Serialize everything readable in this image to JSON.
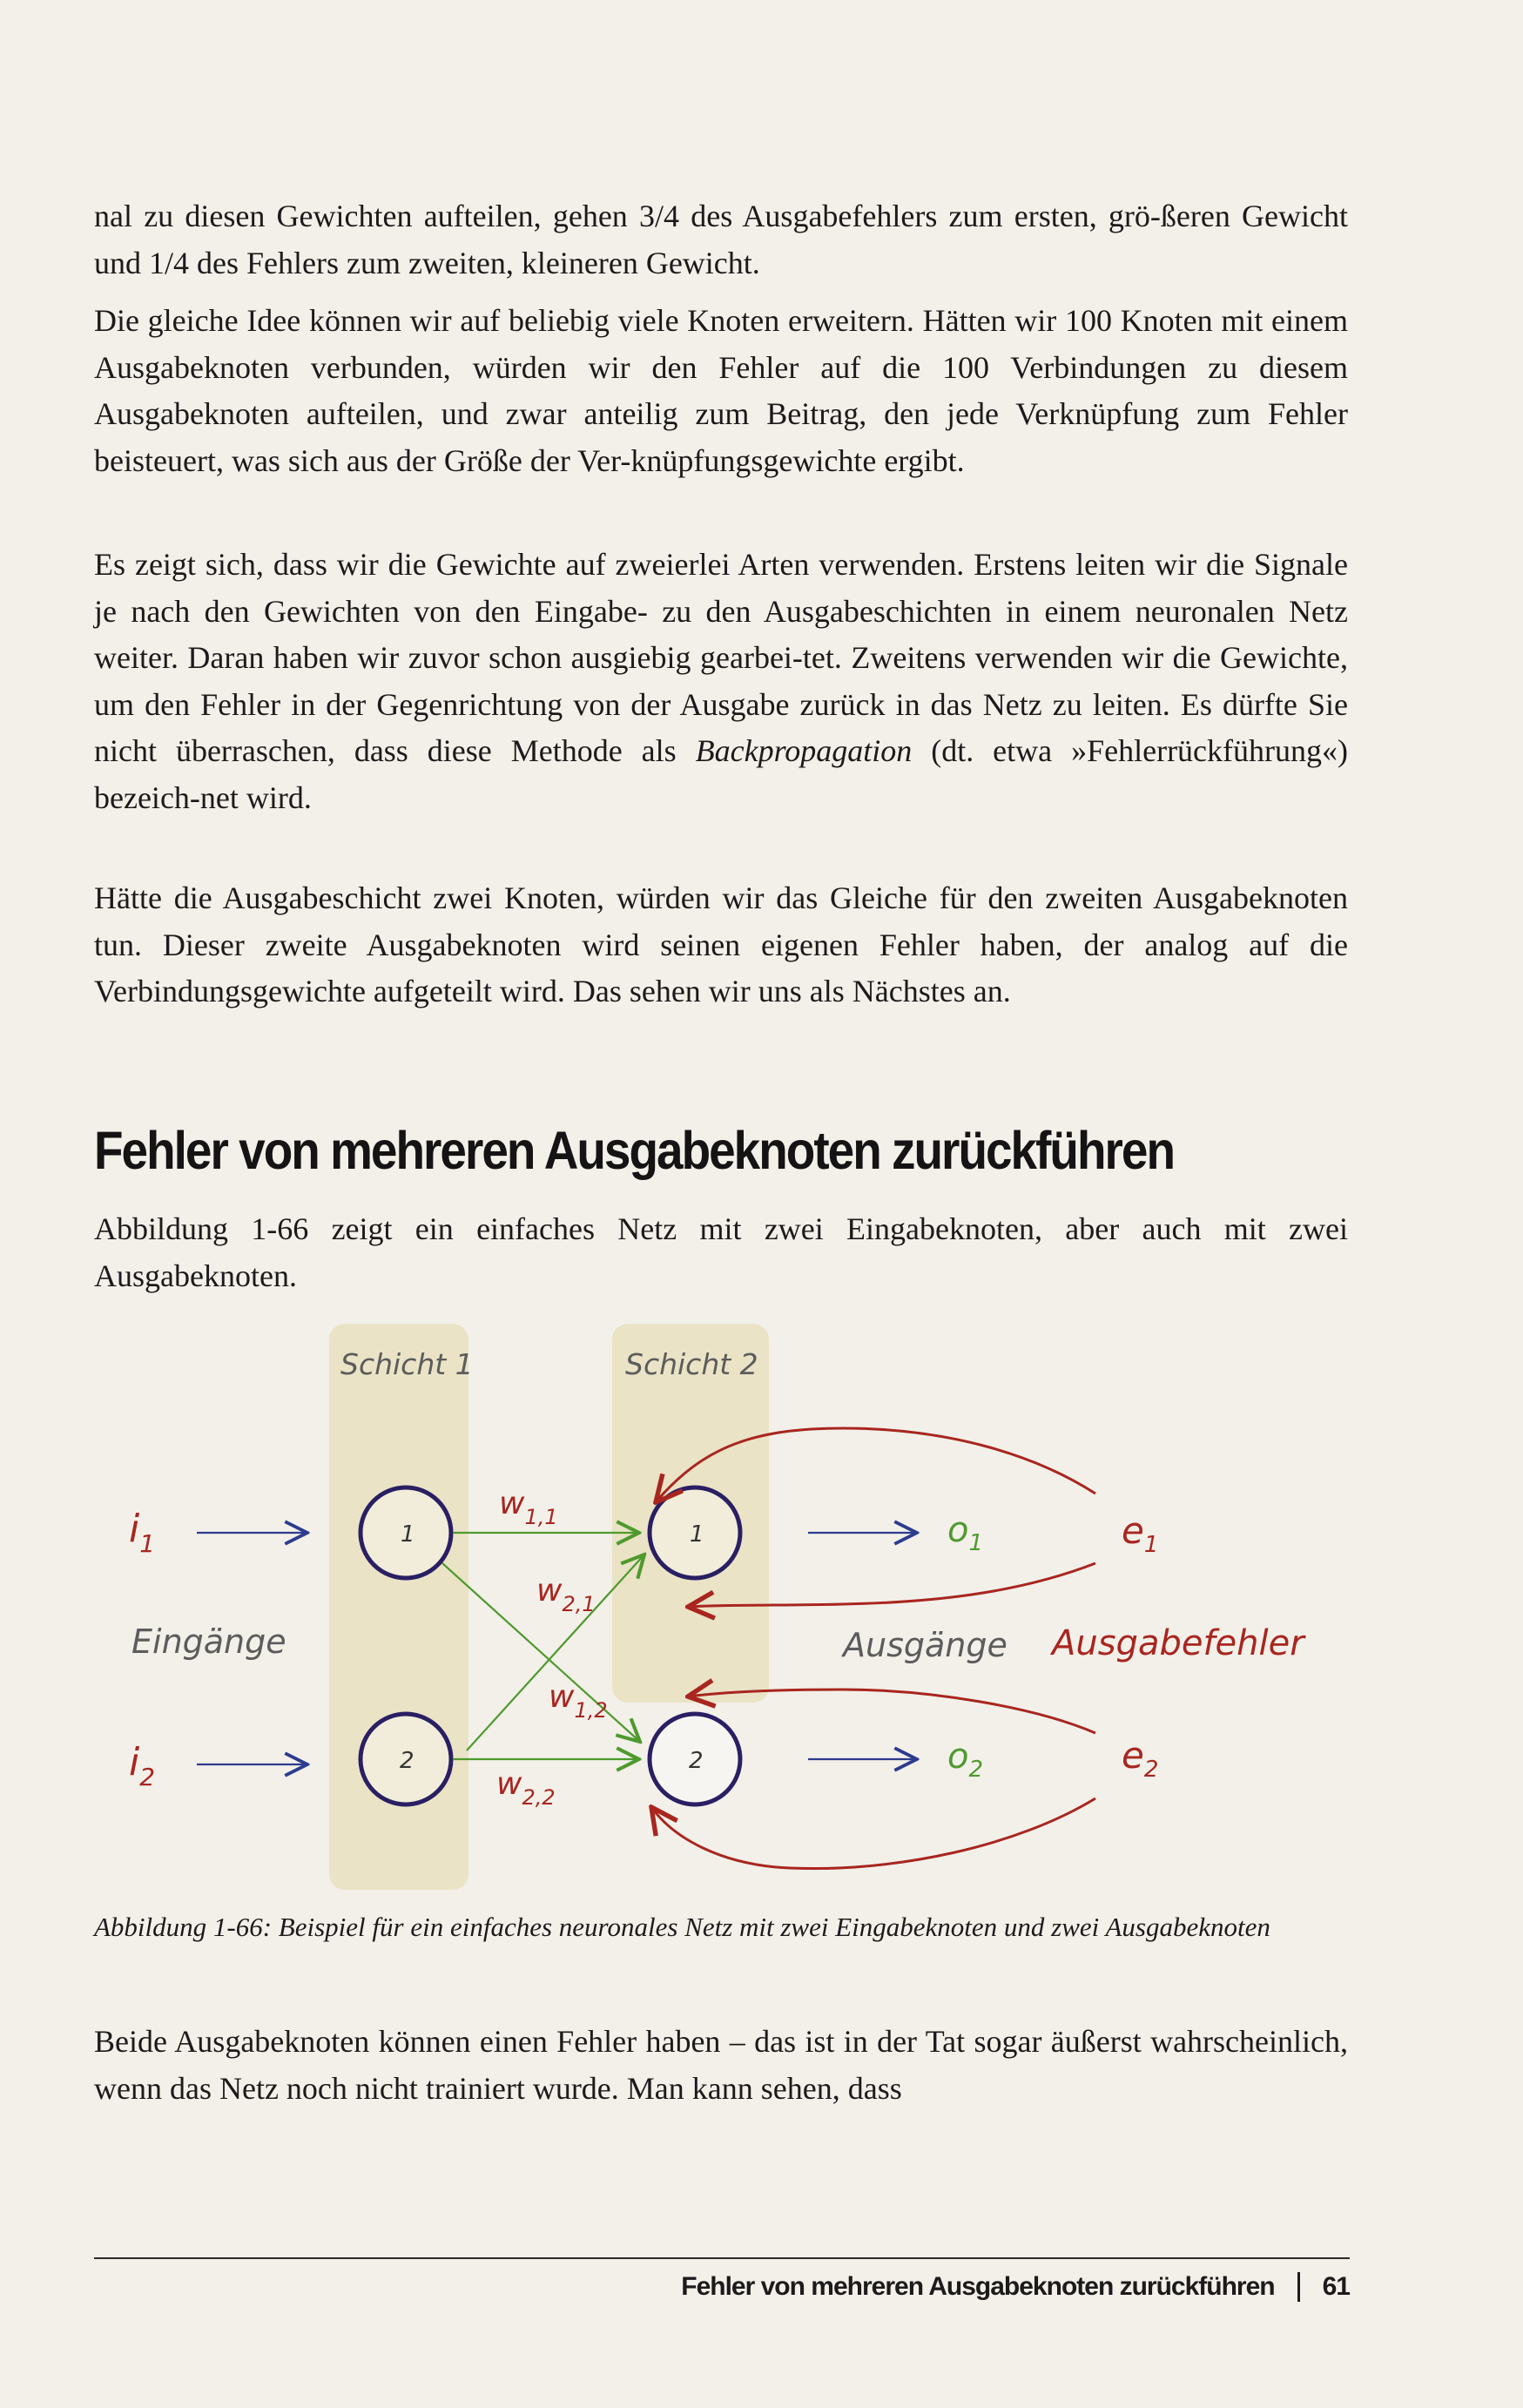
{
  "paragraphs": {
    "p1": "nal zu diesen Gewichten aufteilen, gehen 3/4 des Ausgabefehlers zum ersten, grö-ßeren Gewicht und 1/4 des Fehlers zum zweiten, kleineren Gewicht.",
    "p2": "Die gleiche Idee können wir auf beliebig viele Knoten erweitern. Hätten wir 100 Knoten mit einem Ausgabeknoten verbunden, würden wir den Fehler auf die 100 Verbindungen zu diesem Ausgabeknoten aufteilen, und zwar anteilig zum Beitrag, den jede Verknüpfung zum Fehler beisteuert, was sich aus der Größe der Ver-knüpfungsgewichte ergibt.",
    "p3a": "Es zeigt sich, dass wir die Gewichte auf zweierlei Arten verwenden. Erstens leiten wir die Signale je nach den Gewichten von den Eingabe- zu den Ausgabeschichten in einem neuronalen Netz weiter. Daran haben wir zuvor schon ausgiebig gearbei-tet. Zweitens verwenden wir die Gewichte, um den Fehler in der Gegenrichtung von der Ausgabe zurück in das Netz zu leiten. Es dürfte Sie nicht überraschen, dass diese Methode als",
    "p3_term": "Backpropagation",
    "p3b": "(dt. etwa »Fehlerrückführung«) bezeich-net wird.",
    "p4": "Hätte die Ausgabeschicht zwei Knoten, würden wir das Gleiche für den zweiten Ausgabeknoten tun. Dieser zweite Ausgabeknoten wird seinen eigenen Fehler haben, der analog auf die Verbindungsgewichte aufgeteilt wird. Das sehen wir uns als Nächstes an.",
    "p5": "Abbildung 1-66 zeigt ein einfaches Netz mit zwei Eingabeknoten, aber auch mit zwei Ausgabeknoten.",
    "p6": "Beide Ausgabeknoten können einen Fehler haben – das ist in der Tat sogar äußerst wahrscheinlich, wenn das Netz noch nicht trainiert wurde. Man kann sehen, dass"
  },
  "heading": "Fehler von mehreren Ausgabeknoten zurückführen",
  "figure": {
    "layer1_label": "Schicht 1",
    "layer2_label": "Schicht 2",
    "input1": "i",
    "input1_sub": "1",
    "input2": "i",
    "input2_sub": "2",
    "node_l1_1": "1",
    "node_l1_2": "2",
    "node_l2_1": "1",
    "node_l2_2": "2",
    "w11": "w",
    "w11_sub": "1,1",
    "w21": "w",
    "w21_sub": "2,1",
    "w12": "w",
    "w12_sub": "1,2",
    "w22": "w",
    "w22_sub": "2,2",
    "out1": "o",
    "out1_sub": "1",
    "out2": "o",
    "out2_sub": "2",
    "err1": "e",
    "err1_sub": "1",
    "err2": "e",
    "err2_sub": "2",
    "inputs_label": "Eingänge",
    "outputs_label": "Ausgänge",
    "errors_label": "Ausgabefehler",
    "colors": {
      "layer_bg": "#e7e1bf",
      "node_stroke": "#2a1f63",
      "input_arrow": "#2c3b8f",
      "weight_green": "#4e9a2d",
      "error_red": "#a8261f",
      "handwriting_gray": "#5c5c5c"
    }
  },
  "caption": "Abbildung 1-66: Beispiel für ein einfaches neuronales Netz mit zwei Eingabeknoten und zwei Ausgabeknoten",
  "footer": {
    "chapter_title": "Fehler von mehreren Ausgabeknoten zurückführen",
    "page_number": "61"
  }
}
